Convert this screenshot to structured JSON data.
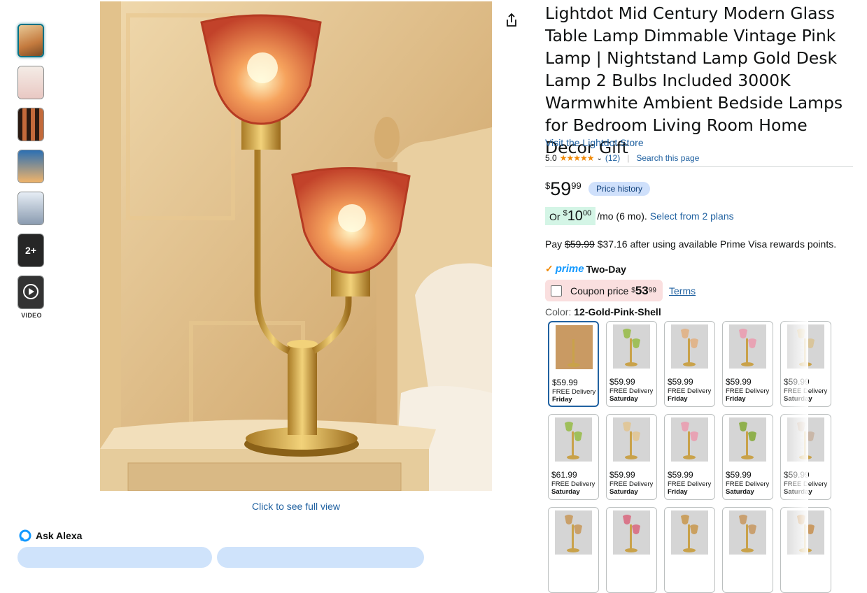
{
  "thumbnails": {
    "more_label": "2+",
    "video_label": "VIDEO"
  },
  "main_image": {
    "click_label": "Click to see full view"
  },
  "ask_alexa": {
    "label": "Ask Alexa"
  },
  "product": {
    "title": "Lightdot Mid Century Modern Glass Table Lamp Dimmable Vintage Pink Lamp | Nightstand Lamp Gold Desk Lamp 2 Bulbs Included 3000K Warmwhite Ambient Bedside Lamps for Bedroom Living Room Home Decor Gift",
    "store_link": "Visit the Lightdot Store",
    "rating": "5.0",
    "stars": "★★★★★",
    "review_count": "(12)",
    "search_page": "Search this page"
  },
  "price": {
    "currency": "$",
    "whole": "59",
    "fraction": "99",
    "history_badge": "Price history"
  },
  "monthly": {
    "or": "Or",
    "currency": "$",
    "whole": "10",
    "fraction": "00",
    "suffix": "/mo (6 mo).",
    "plans_link": "Select from 2 plans"
  },
  "rewards": {
    "pay": "Pay",
    "original": "$59.99",
    "text": "$37.16 after using available Prime Visa rewards points."
  },
  "prime": {
    "check": "✓",
    "logo": "prime",
    "label": "Two-Day"
  },
  "coupon": {
    "label": "Coupon price",
    "currency": "$",
    "whole": "53",
    "fraction": "99",
    "terms": "Terms"
  },
  "color": {
    "label": "Color:",
    "value": "12-Gold-Pink-Shell"
  },
  "swatches": [
    {
      "price": "$59.99",
      "delivery": "FREE Delivery",
      "day": "Friday"
    },
    {
      "price": "$59.99",
      "delivery": "FREE Delivery",
      "day": "Saturday"
    },
    {
      "price": "$59.99",
      "delivery": "FREE Delivery",
      "day": "Friday"
    },
    {
      "price": "$59.99",
      "delivery": "FREE Delivery",
      "day": "Friday"
    },
    {
      "price": "$59.99",
      "delivery": "FREE Delivery",
      "day": "Saturday"
    },
    {
      "price": "$61.99",
      "delivery": "FREE Delivery",
      "day": "Saturday"
    },
    {
      "price": "$59.99",
      "delivery": "FREE Delivery",
      "day": "Saturday"
    },
    {
      "price": "$59.99",
      "delivery": "FREE Delivery",
      "day": "Friday"
    },
    {
      "price": "$59.99",
      "delivery": "FREE Delivery",
      "day": "Saturday"
    },
    {
      "price": "$59.99",
      "delivery": "FREE Delivery",
      "day": "Saturday"
    }
  ],
  "colors": {
    "link": "#2162a1",
    "star": "#f08804",
    "prime_blue": "#1399ff",
    "price_history_bg": "#cfe0fb",
    "coupon_bg": "#fadfdf",
    "green_bg": "#d4f5e6"
  }
}
